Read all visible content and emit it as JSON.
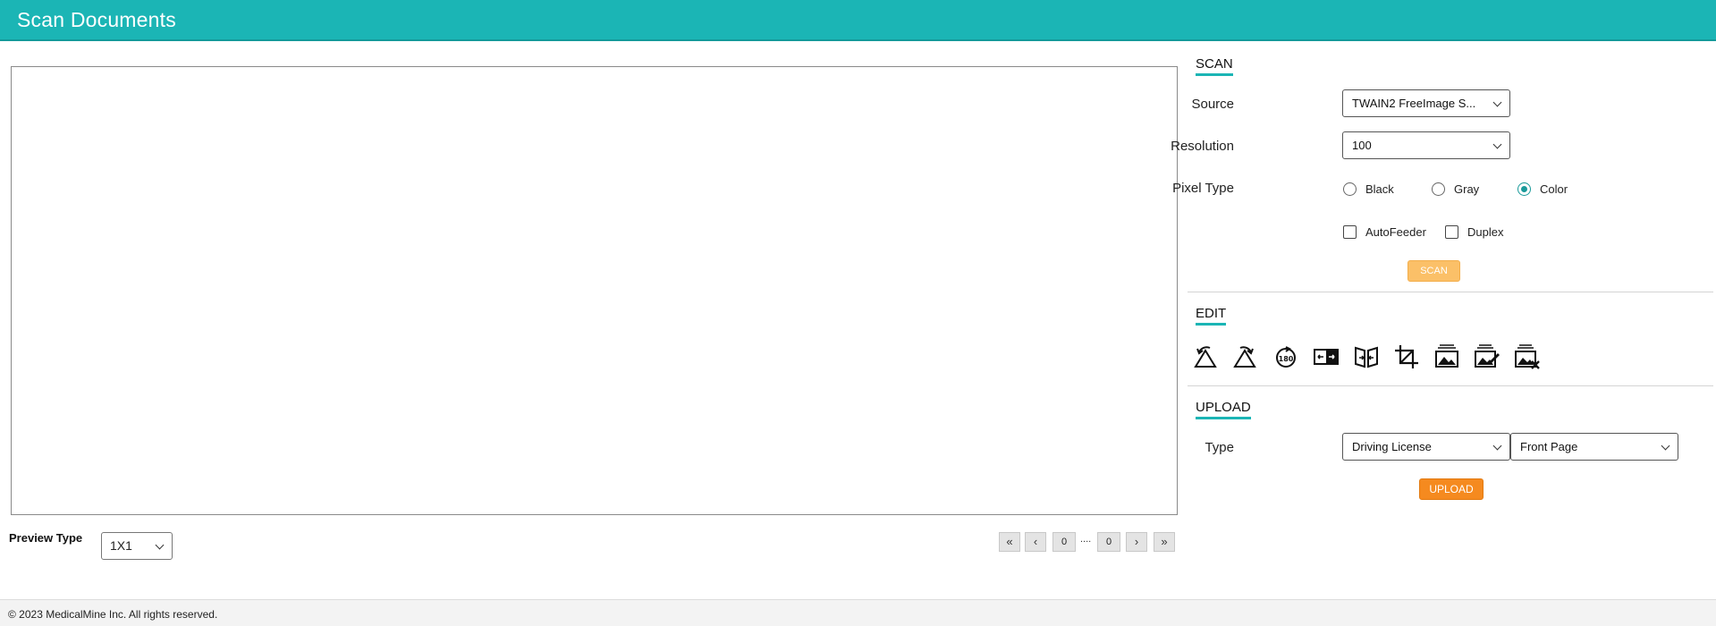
{
  "header": {
    "title": "Scan Documents"
  },
  "preview": {
    "type_label": "Preview Type",
    "type_value": "1X1"
  },
  "pager": {
    "first": "«",
    "prev": "‹",
    "current": "0",
    "separator": "....",
    "total": "0",
    "next": "›",
    "last": "»"
  },
  "scan": {
    "title": "SCAN",
    "source_label": "Source",
    "source_value": "TWAIN2 FreeImage S...",
    "resolution_label": "Resolution",
    "resolution_value": "100",
    "pixel_type_label": "Pixel Type",
    "pixel_options": [
      "Black",
      "Gray",
      "Color"
    ],
    "pixel_selected": "Color",
    "autofeeder_label": "AutoFeeder",
    "duplex_label": "Duplex",
    "scan_button": "SCAN"
  },
  "edit": {
    "title": "EDIT",
    "tools": [
      "rotate-left-icon",
      "rotate-right-icon",
      "rotate-180-icon",
      "mirror-icon",
      "flip-icon",
      "crop-icon",
      "image-icon",
      "image-edit-icon",
      "image-delete-icon"
    ]
  },
  "upload": {
    "title": "UPLOAD",
    "type_label": "Type",
    "type_value": "Driving License",
    "page_value": "Front Page",
    "upload_button": "UPLOAD"
  },
  "footer": {
    "copyright": "© 2023 MedicalMine Inc. All rights reserved."
  },
  "colors": {
    "header": "#1bb5b5",
    "accent": "#1bb5b5",
    "scan_button": "#fbc068",
    "upload_button": "#f58a1f"
  }
}
